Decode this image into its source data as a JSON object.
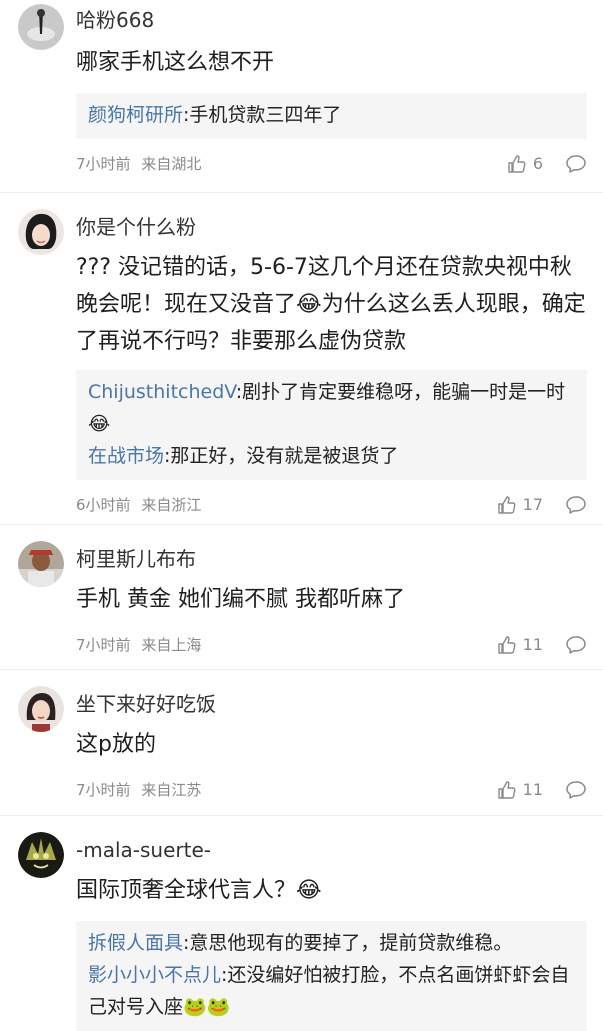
{
  "comments": [
    {
      "username": "哈粉668",
      "text": "哪家手机这么想不开",
      "replies": [
        {
          "author": "颜狗柯研所",
          "text": ":手机贷款三四年了"
        }
      ],
      "time": "7小时前",
      "location": "来自湖北",
      "likes": "6"
    },
    {
      "username": "你是个什么粉",
      "text": "??? 没记错的话，5-6-7这几个月还在贷款央视中秋晚会呢！现在又没音了😂为什么这么丢人现眼，确定了再说不行吗？非要那么虚伪贷款",
      "replies": [
        {
          "author": "ChijusthitchedV",
          "text": ":剧扑了肯定要维稳呀，能骗一时是一时😂"
        },
        {
          "author": "在战市场",
          "text": ":那正好，没有就是被退货了"
        }
      ],
      "time": "6小时前",
      "location": "来自浙江",
      "likes": "17"
    },
    {
      "username": "柯里斯儿布布",
      "text": "手机 黄金 她们编不腻 我都听麻了",
      "replies": [],
      "time": "7小时前",
      "location": "来自上海",
      "likes": "11"
    },
    {
      "username": "坐下来好好吃饭",
      "text": "这p放的",
      "replies": [],
      "time": "7小时前",
      "location": "来自江苏",
      "likes": "11"
    },
    {
      "username": "-mala-suerte-",
      "text": "国际顶奢全球代言人？😂",
      "replies": [
        {
          "author": "拆假人面具",
          "text": ":意思他现有的要掉了，提前贷款维稳。"
        },
        {
          "author": "影小小小不点儿",
          "text": ":还没编好怕被打脸，不点名画饼虾虾会自己对号入座🐸🐸"
        }
      ],
      "time": "",
      "location": "",
      "likes": ""
    }
  ],
  "icons": {
    "like": "thumbs-up-icon",
    "reply": "comment-bubble-icon"
  },
  "colors": {
    "reply_author": "#4a76a8",
    "meta": "#8a8a8a",
    "reply_bg": "#f5f5f5"
  }
}
